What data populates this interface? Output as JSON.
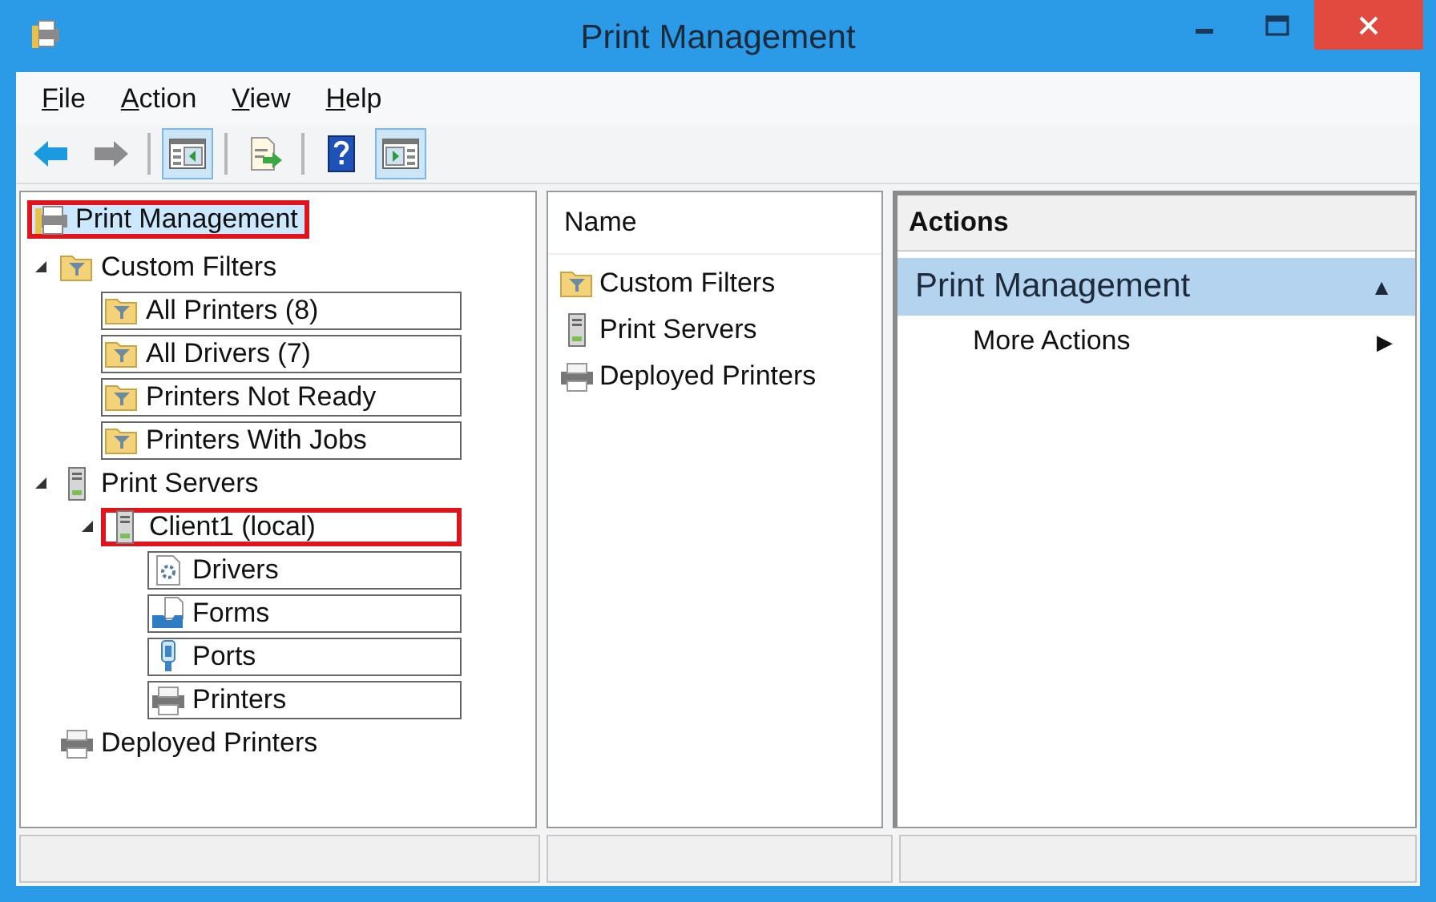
{
  "window": {
    "title": "Print Management"
  },
  "menu": [
    "File",
    "Action",
    "View",
    "Help"
  ],
  "toolbar": [
    {
      "kind": "back",
      "pressed": false
    },
    {
      "kind": "forward",
      "pressed": false
    },
    {
      "kind": "separator"
    },
    {
      "kind": "console-tree",
      "pressed": true
    },
    {
      "kind": "separator"
    },
    {
      "kind": "export",
      "pressed": false
    },
    {
      "kind": "separator"
    },
    {
      "kind": "help",
      "pressed": false
    },
    {
      "kind": "action-pane",
      "pressed": true
    }
  ],
  "tree": [
    {
      "label": "Print Management",
      "kind": "management",
      "selected": true,
      "highlighted": true,
      "framed": false,
      "children": [
        {
          "label": "Custom Filters",
          "kind": "filter-folder",
          "selected": false,
          "highlighted": false,
          "framed": false,
          "expanded": true,
          "children": [
            {
              "label": "All Printers (8)",
              "kind": "filter-folder",
              "selected": false,
              "highlighted": false,
              "framed": true
            },
            {
              "label": "All Drivers (7)",
              "kind": "filter-folder",
              "selected": false,
              "highlighted": false,
              "framed": true
            },
            {
              "label": "Printers Not Ready",
              "kind": "filter-folder",
              "selected": false,
              "highlighted": false,
              "framed": true
            },
            {
              "label": "Printers With Jobs",
              "kind": "filter-folder",
              "selected": false,
              "highlighted": false,
              "framed": true
            }
          ]
        },
        {
          "label": "Print Servers",
          "kind": "server",
          "selected": false,
          "highlighted": false,
          "framed": false,
          "expanded": true,
          "children": [
            {
              "label": "Client1 (local)",
              "kind": "server",
              "selected": false,
              "highlighted": true,
              "framed": false,
              "expanded": true,
              "children": [
                {
                  "label": "Drivers",
                  "kind": "drivers",
                  "selected": false,
                  "highlighted": false,
                  "framed": true
                },
                {
                  "label": "Forms",
                  "kind": "forms",
                  "selected": false,
                  "highlighted": false,
                  "framed": true
                },
                {
                  "label": "Ports",
                  "kind": "ports",
                  "selected": false,
                  "highlighted": false,
                  "framed": true
                },
                {
                  "label": "Printers",
                  "kind": "printer",
                  "selected": false,
                  "highlighted": false,
                  "framed": true
                }
              ]
            }
          ]
        },
        {
          "label": "Deployed Printers",
          "kind": "printer",
          "selected": false,
          "highlighted": false,
          "framed": false
        }
      ]
    }
  ],
  "list": {
    "column": "Name",
    "items": [
      {
        "label": "Custom Filters",
        "kind": "filter-folder"
      },
      {
        "label": "Print Servers",
        "kind": "server"
      },
      {
        "label": "Deployed Printers",
        "kind": "printer"
      }
    ]
  },
  "actions": {
    "title": "Actions",
    "sections": [
      {
        "label": "Print Management",
        "toggle": "▲",
        "items": [
          {
            "label": "More Actions",
            "arrow": "▶"
          }
        ]
      }
    ]
  }
}
